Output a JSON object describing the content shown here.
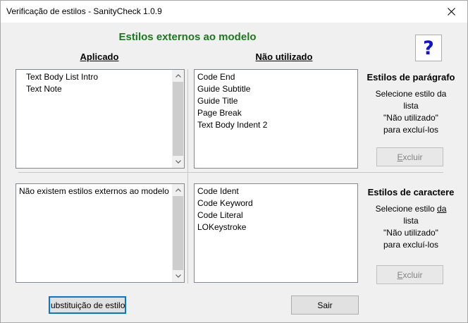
{
  "window": {
    "title": "Verificação de estilos - SanityCheck 1.0.9"
  },
  "heading": "Estilos externos ao modelo",
  "help_label": "?",
  "columns": {
    "applied": "Aplicado",
    "unused": "Não utilizado"
  },
  "paragraph": {
    "applied_items": [
      "Text Body List Intro",
      "Text Note"
    ],
    "unused_items": [
      "Code End",
      "Guide Subtitle",
      "Guide Title",
      "Page Break",
      "Text Body Indent 2"
    ],
    "side_title": "Estilos de parágrafo",
    "side_line1": "Selecione estilo da",
    "side_line2": "lista",
    "side_line3": "\"Não utilizado\"",
    "side_line4": "para excluí-los",
    "delete_first": "E",
    "delete_rest": "xcluir"
  },
  "character": {
    "applied_items": [
      "Não existem estilos externos ao modelo"
    ],
    "unused_items": [
      "Code Ident",
      "Code Keyword",
      "Code Literal",
      "LOKeystroke"
    ],
    "side_title": "Estilos de caractere",
    "side_line1_a": "Selecione estilo ",
    "side_line1_b": "da",
    "side_line2": "lista",
    "side_line3": "\"Não utilizado\"",
    "side_line4": "para excluí-los",
    "delete_first": "E",
    "delete_rest": "xcluir"
  },
  "buttons": {
    "substitution": "ubstituição de estilo",
    "exit": "Sair"
  },
  "colors": {
    "heading": "#1a7a1a",
    "help_mark": "#1010d8",
    "focus": "#0078d7"
  }
}
